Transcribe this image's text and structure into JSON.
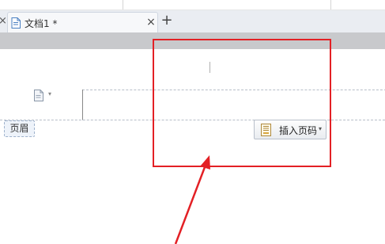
{
  "tabs": {
    "document_tab": {
      "title": "文档1 *",
      "close_glyph": "×"
    },
    "left_close_glyph": "×",
    "new_tab_glyph": "+"
  },
  "header_area": {
    "label": "页眉",
    "caret_glyph": "▾"
  },
  "insert_page_number_button": {
    "label": "插入页码",
    "caret_glyph": "▾"
  },
  "annotation": {
    "highlight_color": "#e32025",
    "arrow_color": "#e32025"
  },
  "icons": [
    "document-icon",
    "page-icon",
    "page-number-icon",
    "close-icon",
    "plus-icon"
  ]
}
